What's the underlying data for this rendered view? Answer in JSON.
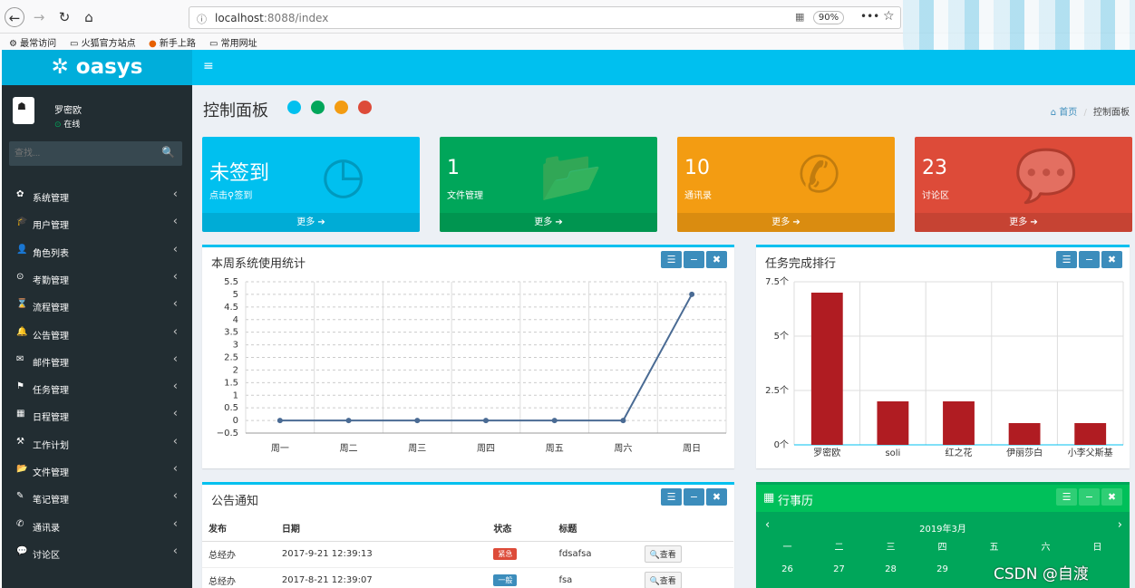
{
  "browser": {
    "url_host": "localhost",
    "url_path": ":8088/index",
    "zoom": "90%",
    "bookmarks": [
      "最常访问",
      "火狐官方站点",
      "新手上路",
      "常用网址"
    ]
  },
  "sidebar": {
    "logo": "oasys",
    "user_name": "罗密欧",
    "user_status": "在线",
    "search_placeholder": "查找...",
    "items": [
      {
        "label": "系统管理",
        "icon": "gear-icon",
        "glyph": "✿"
      },
      {
        "label": "用户管理",
        "icon": "graduation-cap-icon",
        "glyph": "🎓"
      },
      {
        "label": "角色列表",
        "icon": "user-icon",
        "glyph": "👤"
      },
      {
        "label": "考勤管理",
        "icon": "clock-icon",
        "glyph": "⊙"
      },
      {
        "label": "流程管理",
        "icon": "hourglass-icon",
        "glyph": "⌛"
      },
      {
        "label": "公告管理",
        "icon": "bell-icon",
        "glyph": "🔔"
      },
      {
        "label": "邮件管理",
        "icon": "envelope-icon",
        "glyph": "✉"
      },
      {
        "label": "任务管理",
        "icon": "flag-icon",
        "glyph": "⚑"
      },
      {
        "label": "日程管理",
        "icon": "calendar-icon",
        "glyph": "▦"
      },
      {
        "label": "工作计划",
        "icon": "tasks-icon",
        "glyph": "⚒"
      },
      {
        "label": "文件管理",
        "icon": "folder-open-icon",
        "glyph": "📂"
      },
      {
        "label": "笔记管理",
        "icon": "edit-icon",
        "glyph": "✎"
      },
      {
        "label": "通讯录",
        "icon": "phone-icon",
        "glyph": "✆"
      },
      {
        "label": "讨论区",
        "icon": "comment-icon",
        "glyph": "💬"
      }
    ]
  },
  "header": {
    "page_title": "控制面板",
    "breadcrumb_home": "首页",
    "breadcrumb_current": "控制面板",
    "color_dots": [
      "#00c0ef",
      "#00a65a",
      "#f39c12",
      "#dd4b39"
    ]
  },
  "stat_boxes": [
    {
      "big": "未签到",
      "small": "点击⚲签到",
      "footer": "更多 ➔",
      "color": "#00c0ef",
      "icon": "clock-icon",
      "glyph": "◷"
    },
    {
      "big": "1",
      "small": "文件管理",
      "footer": "更多 ➔",
      "color": "#00a65a",
      "icon": "folder-open-icon",
      "glyph": "📂"
    },
    {
      "big": "10",
      "small": "通讯录",
      "footer": "更多 ➔",
      "color": "#f39c12",
      "icon": "phone-icon",
      "glyph": "✆"
    },
    {
      "big": "23",
      "small": "讨论区",
      "footer": "更多 ➔",
      "color": "#dd4b39",
      "icon": "comment-icon",
      "glyph": "💬"
    }
  ],
  "line_panel_title": "本周系统使用统计",
  "bar_panel_title": "任务完成排行",
  "notice": {
    "title": "公告通知",
    "columns": [
      "发布",
      "日期",
      "状态",
      "标题",
      ""
    ],
    "rows": [
      {
        "publisher": "总经办",
        "date": "2017-9-21 12:39:13",
        "status": "紧急",
        "status_color": "#dd4b39",
        "subject": "fdsafsa",
        "action": "查看"
      },
      {
        "publisher": "总经办",
        "date": "2017-8-21 12:39:07",
        "status": "一般",
        "status_color": "#3c8dbc",
        "subject": "fsa",
        "action": "查看"
      }
    ]
  },
  "calendar": {
    "title": "行事历",
    "month": "2019年3月",
    "weekdays": [
      "一",
      "二",
      "三",
      "四",
      "五",
      "六",
      "日"
    ],
    "first_row": [
      "26",
      "27",
      "28",
      "29",
      "",
      "",
      ""
    ]
  },
  "watermark": "CSDN @自渡",
  "chart_data": [
    {
      "type": "line",
      "title": "本周系统使用统计",
      "categories": [
        "周一",
        "周二",
        "周三",
        "周四",
        "周五",
        "周六",
        "周日"
      ],
      "values": [
        0,
        0,
        0,
        0,
        0,
        0,
        5
      ],
      "ylim": [
        -0.5,
        5.5
      ],
      "yticks": [
        "5.5",
        "5",
        "4.5",
        "4",
        "3.5",
        "3",
        "2.5",
        "2",
        "1.5",
        "1",
        "0.5",
        "0",
        "−0.5"
      ],
      "color": "#4a6b94",
      "grid": true
    },
    {
      "type": "bar",
      "title": "任务完成排行",
      "categories": [
        "罗密欧",
        "soli",
        "红之花",
        "伊丽莎白",
        "小李父斯基"
      ],
      "values": [
        7,
        2,
        2,
        1,
        1
      ],
      "ylim": [
        0,
        7.5
      ],
      "yticks": [
        "7.5个",
        "5个",
        "2.5个",
        "0个"
      ],
      "color": "#b01c22",
      "grid": true
    }
  ]
}
